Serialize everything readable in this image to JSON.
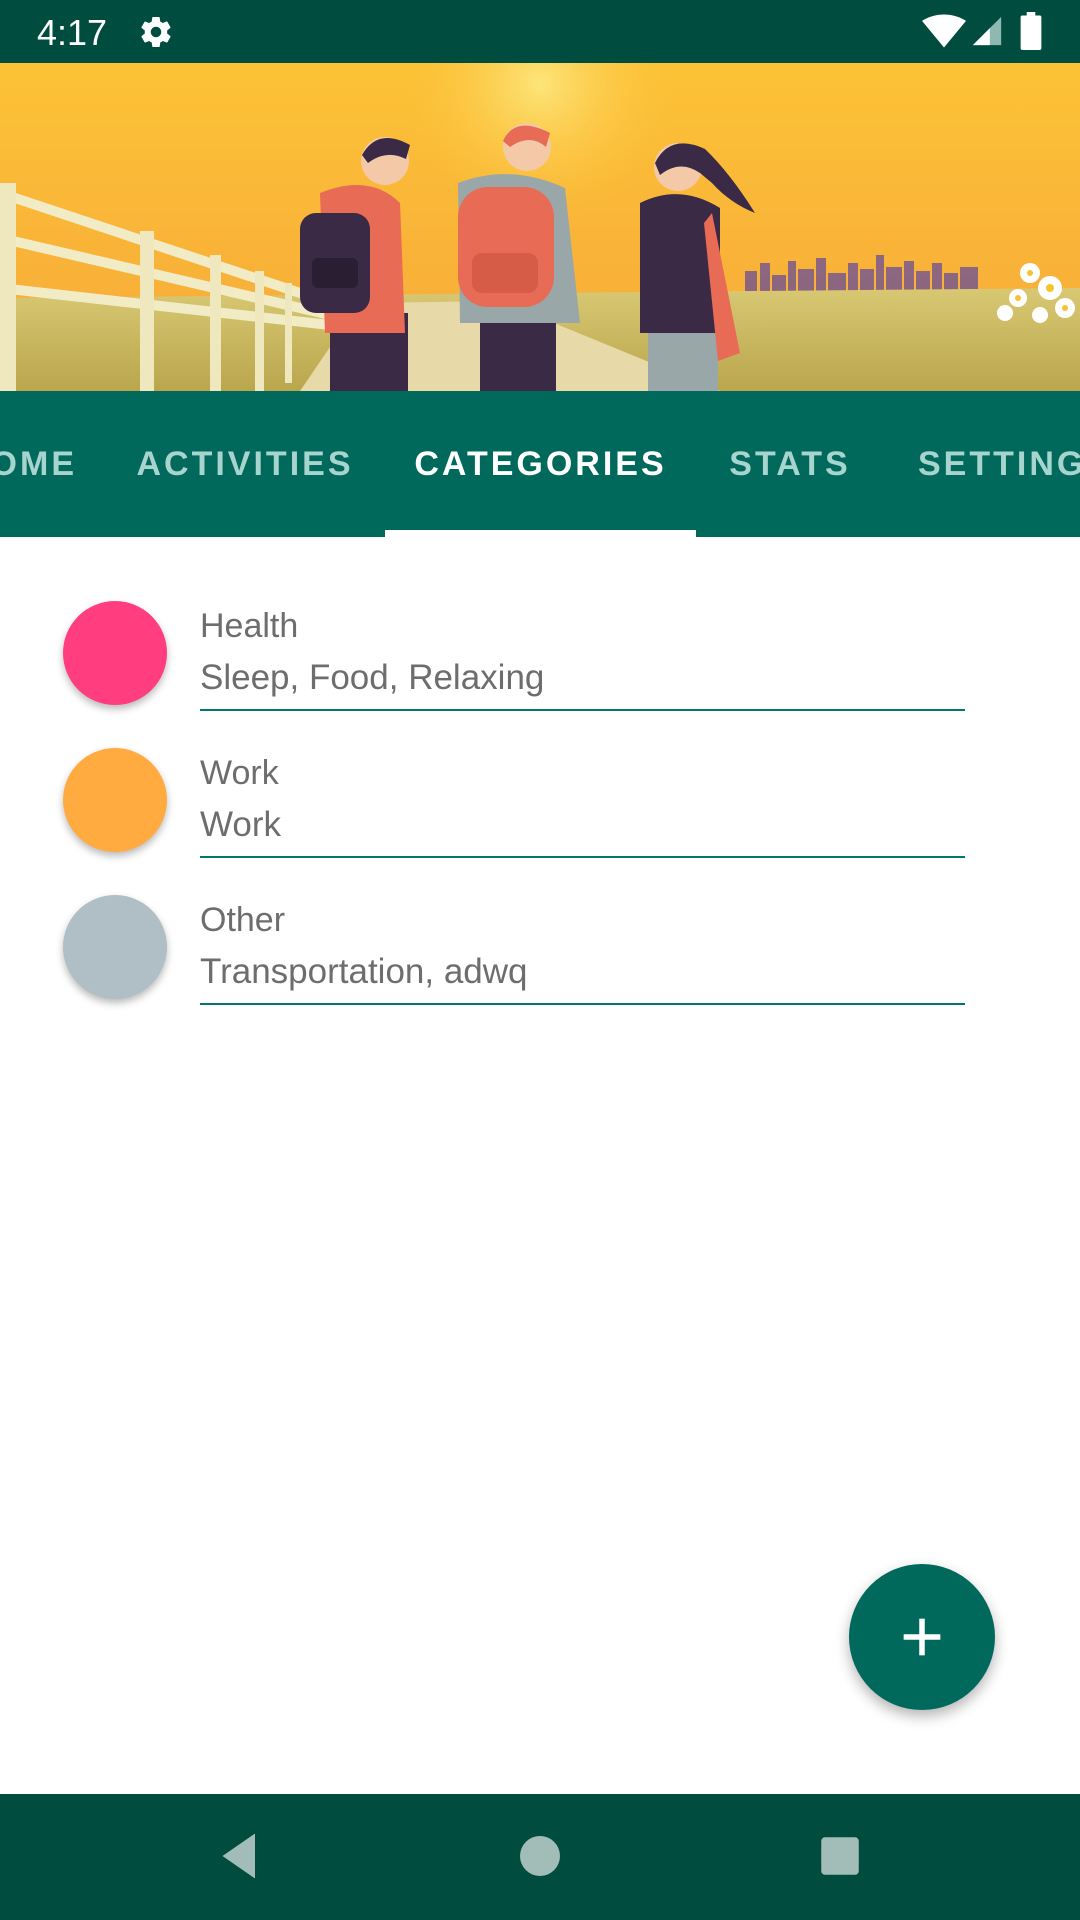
{
  "status_bar": {
    "time": "4:17",
    "icons": [
      "gear-icon",
      "wifi-icon",
      "signal-icon",
      "battery-icon"
    ]
  },
  "header": {
    "image": "travel-illustration"
  },
  "tabs": [
    {
      "label": "HOME",
      "active": false
    },
    {
      "label": "ACTIVITIES",
      "active": false
    },
    {
      "label": "CATEGORIES",
      "active": true
    },
    {
      "label": "STATS",
      "active": false
    },
    {
      "label": "SETTINGS",
      "active": false
    }
  ],
  "categories": [
    {
      "name": "Health",
      "items": "Sleep, Food, Relaxing",
      "color": "#ff3d7f"
    },
    {
      "name": "Work",
      "items": "Work",
      "color": "#ffab40"
    },
    {
      "name": "Other",
      "items": "Transportation, adwq",
      "color": "#b0bec5"
    }
  ],
  "fab": {
    "icon": "plus-icon"
  },
  "nav_bar": {
    "icons": [
      "back-icon",
      "home-icon",
      "recents-icon"
    ]
  },
  "colors": {
    "status_bar": "#004d40",
    "tab_bar": "#00695c",
    "accent": "#00796b"
  }
}
